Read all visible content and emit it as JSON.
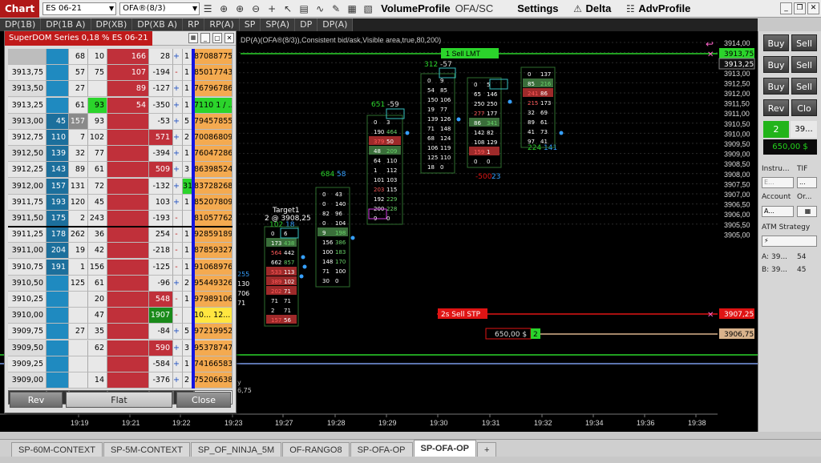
{
  "toolbar": {
    "chart_tab": "Chart",
    "instrument": "ES 06-21",
    "template": "OFA®(8/3)",
    "volume_profile": "VolumeProfile",
    "ofa_sc": "OFA/SC",
    "settings": "Settings",
    "delta": "Delta",
    "adv_profile": "AdvProfile"
  },
  "indicator_tabs": [
    "DP(1B)",
    "DP(1B A)",
    "DP(XB)",
    "DP(XB A)",
    "RP",
    "RP(A)",
    "SP",
    "SP(A)",
    "DP",
    "DP(A)"
  ],
  "chart": {
    "info": "DP(A)(OFA®(8/3)),Consistent bid/ask,Visible area,true,80,200)",
    "price_labels": [
      "3914,00",
      "3913,50",
      "3913,25",
      "3913,00",
      "3912,50",
      "3912,00",
      "3911,50",
      "3911,00",
      "3910,50",
      "3910,00",
      "3909,50",
      "3909,00",
      "3908,50",
      "3908,00",
      "3907,50",
      "3907,00",
      "3906,50",
      "3906,00",
      "3905,50",
      "3905,00"
    ],
    "time_labels": [
      "19:19",
      "19:21",
      "19:22",
      "19:23",
      "19:27",
      "19:28",
      "19:29",
      "19:30",
      "19:31",
      "19:32",
      "19:34",
      "19:36",
      "19:38"
    ],
    "sell_lmt": {
      "label": "1  Sell LMT",
      "price": "3913,75"
    },
    "sell_stp": {
      "label": "2s  Sell STP",
      "price": "3907,25"
    },
    "position": {
      "pnl": "650,00 $",
      "qty": "2",
      "price": "3906,75"
    },
    "current_price": "3913,25",
    "target": {
      "line1": "Target1",
      "line2": "2 @ 3908,25"
    },
    "clusters": [
      {
        "head1": "312",
        "head2": "-57"
      },
      {
        "head1": "651",
        "head2": "-59"
      },
      {
        "head1": "684",
        "head2": "58"
      },
      {
        "head1": "102",
        "head2": "18"
      },
      {
        "head1": "-500",
        "head2": "23"
      },
      {
        "head1": "224",
        "head2": "141"
      }
    ],
    "cluster_cells": [
      {
        "set": "c1",
        "rows": [
          [
            "0",
            "9"
          ],
          [
            "54",
            "85"
          ],
          [
            "150",
            "106"
          ],
          [
            "19",
            "77"
          ],
          [
            "139",
            "126"
          ],
          [
            "71",
            "148"
          ],
          [
            "68",
            "124"
          ],
          [
            "106",
            "119"
          ],
          [
            "125",
            "110"
          ],
          [
            "18",
            "0"
          ]
        ]
      },
      {
        "set": "c2",
        "rows": [
          [
            "0",
            "3"
          ],
          [
            "190",
            "464"
          ],
          [
            "379",
            "50"
          ],
          [
            "48",
            "209"
          ],
          [
            "64",
            "110"
          ],
          [
            "1",
            "112"
          ],
          [
            "101",
            "103"
          ],
          [
            "203",
            "115"
          ],
          [
            "192",
            "229"
          ],
          [
            "200",
            "228"
          ],
          [
            "9",
            "0"
          ]
        ]
      },
      {
        "set": "c3",
        "rows": [
          [
            "0",
            "43"
          ],
          [
            "0",
            "140"
          ],
          [
            "82",
            "96"
          ],
          [
            "0",
            "104"
          ],
          [
            "9",
            "198"
          ],
          [
            "156",
            "386"
          ],
          [
            "100",
            "183"
          ],
          [
            "148",
            "170"
          ],
          [
            "71",
            "100"
          ],
          [
            "30",
            "0"
          ]
        ]
      },
      {
        "set": "c4",
        "rows": [
          [
            "0",
            "6"
          ],
          [
            "173",
            "438"
          ],
          [
            "564",
            "442"
          ],
          [
            "662",
            "857"
          ],
          [
            "533",
            "113"
          ],
          [
            "389",
            "102"
          ],
          [
            "202",
            "71"
          ],
          [
            "71",
            "71"
          ],
          [
            "2",
            "71"
          ],
          [
            "157",
            "56"
          ]
        ]
      },
      {
        "set": "c5",
        "rows": [
          [
            "0",
            "5"
          ],
          [
            "65",
            "146"
          ],
          [
            "250",
            "250"
          ],
          [
            "277",
            "177"
          ],
          [
            "86",
            "341"
          ],
          [
            "142",
            "82"
          ],
          [
            "108",
            "129"
          ],
          [
            "159",
            "1"
          ],
          [
            "0",
            "0"
          ]
        ]
      },
      {
        "set": "c6",
        "rows": [
          [
            "0",
            "137"
          ],
          [
            "85",
            "216"
          ],
          [
            "241",
            "86"
          ],
          [
            "215",
            "173"
          ],
          [
            "32",
            "69"
          ],
          [
            "89",
            "61"
          ],
          [
            "41",
            "73"
          ],
          [
            "97",
            "41"
          ]
        ]
      }
    ],
    "left_partial": {
      "row1": "255",
      "row2": "130",
      "row3": "706",
      "row4": "71",
      "row5": "y",
      "row6": "6,75"
    }
  },
  "superdom": {
    "title": "SuperDOM Series 0,18 % ES 06-21",
    "prices": [
      "",
      "3913,75",
      "3913,50",
      "3913,25",
      "3913,00",
      "3912,75",
      "3912,50",
      "3912,25",
      "3912,00",
      "3911,75",
      "3911,50",
      "3911,25",
      "3911,00",
      "3910,75",
      "3910,50",
      "3910,25",
      "3910,00",
      "3909,75",
      "3909,50",
      "3909,25",
      "3909,00"
    ],
    "bid_size": [
      "",
      "",
      "",
      "",
      "45",
      "110",
      "139",
      "143",
      "157",
      "193",
      "175",
      "178",
      "204",
      "191",
      "",
      "",
      "",
      "",
      "",
      "",
      ""
    ],
    "vol_a": [
      "68",
      "57",
      "27",
      "61",
      "157",
      "7",
      "32",
      "89",
      "131",
      "120",
      "2",
      "262",
      "19",
      "1",
      "125",
      "",
      "",
      "27",
      "",
      "",
      ""
    ],
    "vol_b": [
      "10",
      "75",
      "",
      "93",
      "93",
      "102",
      "77",
      "61",
      "72",
      "45",
      "243",
      "36",
      "42",
      "156",
      "61",
      "20",
      "47",
      "35",
      "62",
      "",
      "14"
    ],
    "ask_size": [
      "166",
      "107",
      "89",
      "54",
      "",
      "",
      "",
      "",
      "",
      "",
      "",
      "",
      "",
      "",
      "",
      "",
      "",
      "",
      "",
      "",
      ""
    ],
    "delta": [
      "28",
      "-194",
      "-127",
      "-350",
      "-53",
      "571",
      "-394",
      "509",
      "-132",
      "103",
      "-193",
      "254",
      "-218",
      "-125",
      "-96",
      "548",
      "1907",
      "-84",
      "590",
      "-584",
      "-376"
    ],
    "signs": [
      "+",
      "-",
      "+",
      "+",
      "+",
      "+",
      "+",
      "+",
      "+",
      "+",
      "-",
      "-",
      "-",
      "-",
      "+",
      "-",
      "-",
      "+",
      "+",
      "+",
      "+"
    ],
    "counts": [
      "1",
      "1",
      "1",
      "1",
      "5",
      "2",
      "1",
      "3",
      "31",
      "1",
      "",
      "1",
      "1",
      "1",
      "2",
      "1",
      "",
      "5",
      "3",
      "1",
      "2"
    ],
    "totals": [
      "87088775",
      "85017743",
      "76796786",
      "7110 1 / ...",
      "79457855",
      "70086809",
      "76047286",
      "86398524",
      "83728268",
      "85207809",
      "81057762",
      "92859189",
      "87859327",
      "91068976",
      "95449326",
      "97989106",
      "10... 12...",
      "97219952",
      "95378747",
      "74166583",
      "75206638"
    ],
    "footer": [
      "≣",
      "↑",
      "✕",
      "↓",
      "✕",
      "✕",
      "✕"
    ],
    "rev": "Rev",
    "flat": "Flat",
    "close": "Close"
  },
  "right_panel": {
    "buy": "Buy",
    "sell": "Sell",
    "rev": "Rev",
    "close": "Clo",
    "qty": "2",
    "qty_price": "39...",
    "pnl": "650,00 $",
    "instrument_label": "Instru...",
    "tif_label": "TIF",
    "instrument_value": "E...",
    "tif_value": "...",
    "account_label": "Account",
    "order_label": "Or...",
    "account_value": "A...",
    "atm_label": "ATM Strategy",
    "atm_value": "⚡",
    "a_label": "A:",
    "a_price": "39...",
    "a_size": "54",
    "b_label": "B:",
    "b_price": "39...",
    "b_size": "45"
  },
  "bottom_tabs": [
    "SP-60M-CONTEXT",
    "SP-5M-CONTEXT",
    "SP_OF_NINJA_5M",
    "OF-RANGO8",
    "SP-OFA-OP",
    "SP-OFA-OP"
  ],
  "colors": {
    "green": "#22c21a",
    "red": "#e01414",
    "blue_bid": "#1f8ac0",
    "bg": "#000000"
  }
}
